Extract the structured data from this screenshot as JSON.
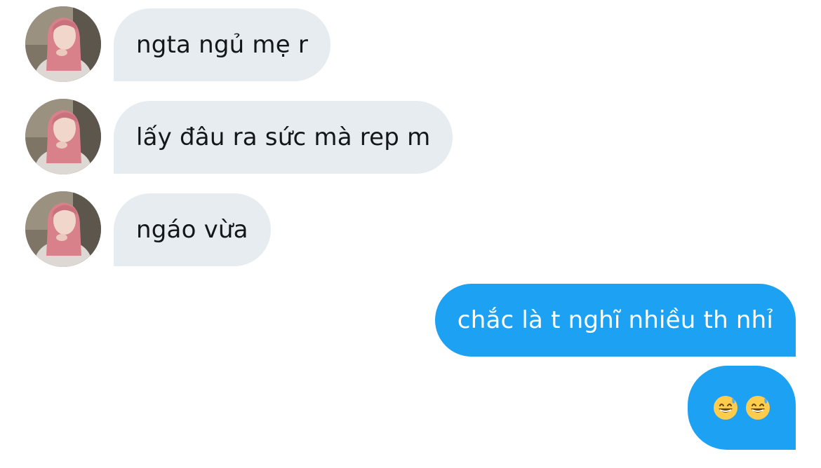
{
  "conversation": {
    "incoming_messages": [
      {
        "text": "ngta ngủ mẹ r"
      },
      {
        "text": "lấy đâu ra sức mà rep m"
      },
      {
        "text": "ngáo vừa"
      }
    ],
    "outgoing_messages": [
      {
        "text": "chắc là t nghĩ nhiều th nhỉ"
      },
      {
        "text": "😅😅",
        "emoji_icons": [
          "grinning-face-with-sweat-icon",
          "grinning-face-with-sweat-icon"
        ]
      }
    ]
  },
  "colors": {
    "incoming_bubble": "#e6ecf0",
    "incoming_text": "#14171a",
    "outgoing_bubble": "#1da1f2",
    "outgoing_text": "#ffffff"
  }
}
